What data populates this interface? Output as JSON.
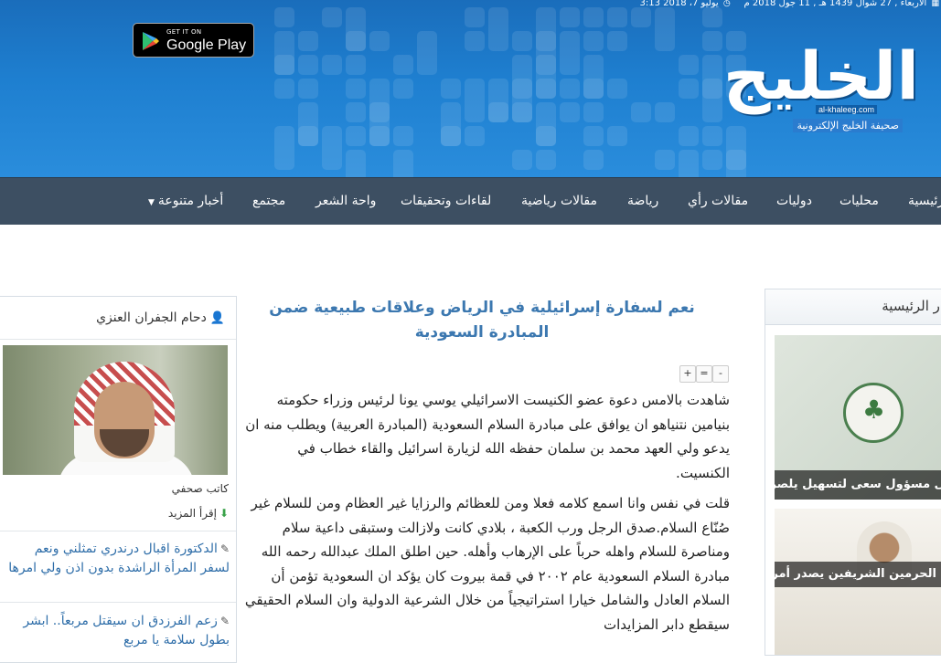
{
  "header": {
    "dateline": {
      "hijri": "الأربعاء , 27 شوال 1439 هـ , 11 جول 2018 م",
      "gregorian": "يوليو 7، 2018",
      "time": "3:13"
    },
    "google_play": {
      "small": "GET IT ON",
      "big": "Google Play"
    },
    "logo": {
      "mark": "الخليج",
      "url": "al-khaleeg.com",
      "tagline": "صحيفة الخليج الإلكترونية"
    }
  },
  "nav": {
    "items": [
      "الرئيسية",
      "محليات",
      "دوليات",
      "مقالات رأي",
      "رياضة",
      "مقالات رياضية",
      "لقاءات وتحقيقات",
      "واحة الشعر",
      "مجتمع",
      "أخبار متنوعة"
    ]
  },
  "sidebar": {
    "title": "الأخبار الرئيسية",
    "cards": [
      {
        "caption": "على مسؤول سعى لتسهيل يلصرف مستحقات مالية الشركات"
      },
      {
        "caption": "خادم الحرمين الشريفين يصدر أمره بالعفو عن كافة العسكريين المشاركين في عملية إعادة الأمل من منسوبي الجهات العسكرية والمسلكية"
      }
    ]
  },
  "article": {
    "title": "نعم لسفارة إسرائيلية في الرياض وعلاقات طبيعية ضمن المبادرة السعودية",
    "font_controls": {
      "increase": "+",
      "reset": "=",
      "decrease": "-"
    },
    "paragraphs": [
      "شاهدت بالامس دعوة عضو الكنيست الاسرائيلي يوسي يونا لرئيس وزراء حكومته بنيامين نتنياهو ان يوافق على مبادرة السلام السعودية (المبادرة العربية) ويطلب منه ان يدعو ولي العهد محمد بن سلمان حفظه الله لزيارة اسرائيل والقاء خطاب في الكنسيت.",
      "قلت في نفس وانا اسمع كلامه فعلا ومن للعظائم والرزايا غير العظام ومن للسلام غير صُنّاع السلام.صدق الرجل ورب الكعبة ، بلادي كانت ولازالت وستبقى داعية سلام ومناصرة للسلام واهله حرباً على الإرهاب وأهله. حين اطلق الملك عبدالله رحمه الله مبادرة السلام السعودية عام ٢٠٠٢ في قمة بيروت كان يؤكد ان السعودية تؤمن أن السلام العادل والشامل خيارا استراتيجياً من خلال الشرعية الدولية وان السلام الحقيقي سيقطع دابر المزايدات"
    ]
  },
  "author": {
    "name": "دحام الجفران العنزي",
    "job": "كاتب صحفي",
    "read_more": "إقرأ المزيد",
    "related": [
      "الدكتورة اقبال درندري تمثلني ونعم لسفر المرأة الراشدة بدون اذن ولي امرها",
      "زعم الفرزدق ان سيقتل مربعاً.. ابشر بطول سلامة يا مربع"
    ]
  },
  "colors": {
    "header_blue": "#1e7fd0",
    "nav_bg": "#3d4f62",
    "title_blue": "#3c78b0",
    "link_blue": "#2f6ea9"
  }
}
